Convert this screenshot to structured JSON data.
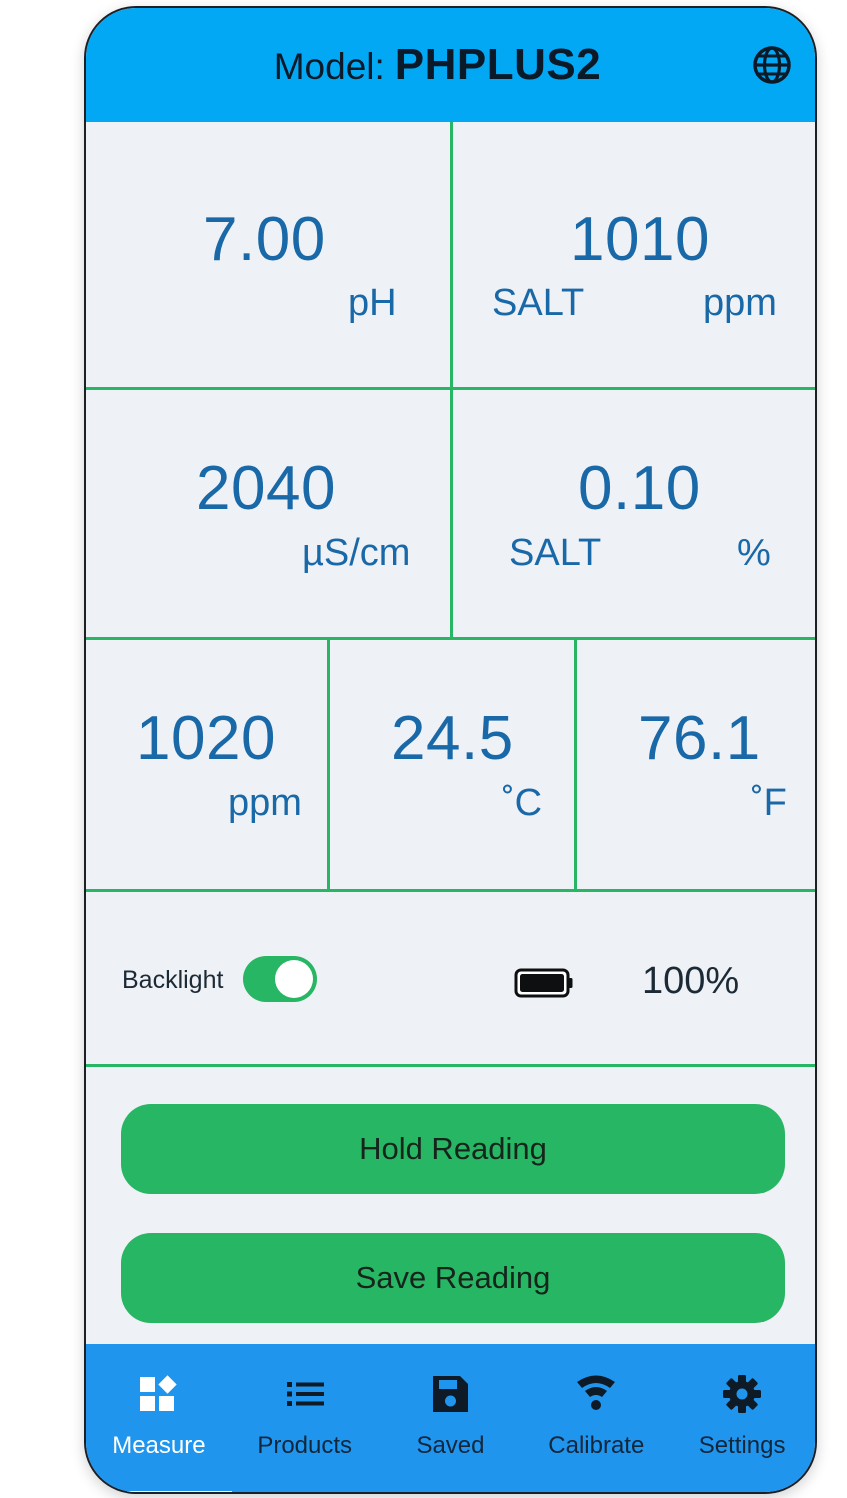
{
  "header": {
    "model_label": "Model:",
    "model_value": "PHPLUS2",
    "language_icon": "globe-icon"
  },
  "readings": {
    "ph": {
      "value": "7.00",
      "unit": "pH"
    },
    "salt_ppm": {
      "value": "1010",
      "label": "SALT",
      "unit": "ppm"
    },
    "conductivity": {
      "value": "2040",
      "unit": "µS/cm"
    },
    "salt_pct": {
      "value": "0.10",
      "label": "SALT",
      "unit": "%"
    },
    "tds": {
      "value": "1020",
      "unit": "ppm"
    },
    "temp_c": {
      "value": "24.5",
      "unit": "˚C"
    },
    "temp_f": {
      "value": "76.1",
      "unit": "˚F"
    }
  },
  "status": {
    "backlight_label": "Backlight",
    "backlight_on": true,
    "battery_icon": "battery-full-icon",
    "battery_pct": "100%"
  },
  "actions": {
    "hold_label": "Hold Reading",
    "save_label": "Save Reading"
  },
  "nav": {
    "items": [
      {
        "label": "Measure",
        "icon": "measure-icon",
        "active": true
      },
      {
        "label": "Products",
        "icon": "list-icon",
        "active": false
      },
      {
        "label": "Saved",
        "icon": "save-icon",
        "active": false
      },
      {
        "label": "Calibrate",
        "icon": "calibrate-icon",
        "active": false
      },
      {
        "label": "Settings",
        "icon": "gear-icon",
        "active": false
      }
    ]
  },
  "colors": {
    "header": "#03a8f4",
    "accent_green": "#27b663",
    "value_blue": "#1968a8",
    "nav_bar": "#1f95ee",
    "background": "#eef1f5"
  }
}
